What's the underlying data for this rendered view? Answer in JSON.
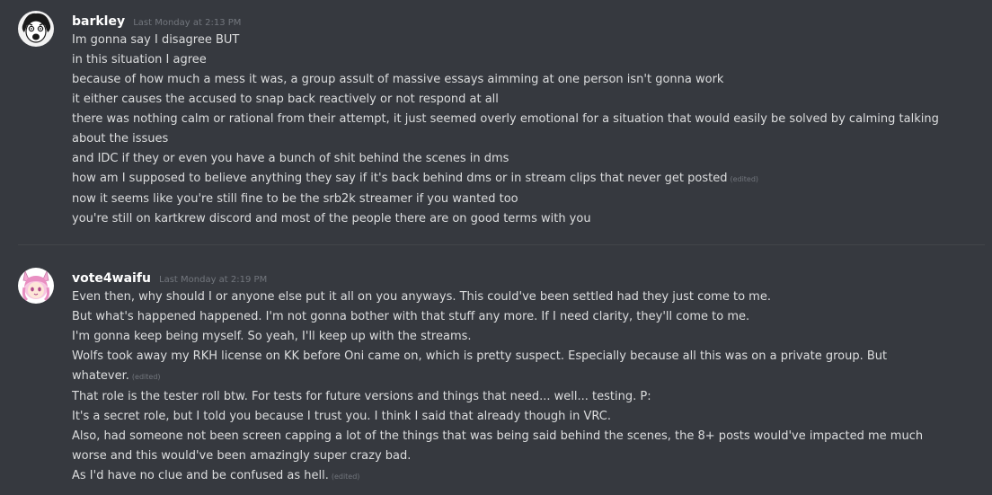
{
  "messages": [
    {
      "username": "barkley",
      "timestamp": "Last Monday at 2:13 PM",
      "avatar_icon": "avatar-barkley-icon",
      "lines": [
        {
          "text": "Im gonna say I disagree BUT",
          "edited": ""
        },
        {
          "text": "in this situation I agree",
          "edited": ""
        },
        {
          "text": "because of how much a mess it was, a group assult of massive essays aimming at one person isn't gonna work",
          "edited": ""
        },
        {
          "text": "it either causes the accused to snap back reactively or not respond at all",
          "edited": ""
        },
        {
          "text": "there was nothing calm or rational from their attempt, it just seemed overly emotional for a situation that would easily be solved by calming talking",
          "edited": ""
        },
        {
          "text": "about the issues",
          "edited": ""
        },
        {
          "text": "and IDC if they or even you have a bunch of shit behind the scenes in dms",
          "edited": ""
        },
        {
          "text": "how am I supposed to believe anything they say if it's back behind dms or in stream clips that never get posted",
          "edited": "(edited)"
        },
        {
          "text": "now it seems like you're still fine to be the srb2k streamer if you wanted too",
          "edited": ""
        },
        {
          "text": "you're still on kartkrew discord and most of the people there are on good terms with you",
          "edited": ""
        }
      ]
    },
    {
      "username": "vote4waifu",
      "timestamp": "Last Monday at 2:19 PM",
      "avatar_icon": "avatar-vote4waifu-icon",
      "lines": [
        {
          "text": "Even then, why should I or anyone else put it all on you anyways. This could've been settled had they just come to me.",
          "edited": ""
        },
        {
          "text": "But what's happened happened. I'm not gonna bother with that stuff any more. If I need clarity, they'll come to me.",
          "edited": ""
        },
        {
          "text": "I'm gonna keep being myself. So yeah, I'll keep up with the streams.",
          "edited": ""
        },
        {
          "text": "Wolfs took away my RKH license on KK before Oni came on, which is pretty suspect. Especially because all this was on a private group. But",
          "edited": ""
        },
        {
          "text": "whatever.",
          "edited": "(edited)"
        },
        {
          "text": "That role is the tester roll btw. For tests for future versions and things that need... well... testing. P:",
          "edited": ""
        },
        {
          "text": "It's a secret role, but I told you because I trust you. I think I said that already though in VRC.",
          "edited": ""
        },
        {
          "text": "Also, had someone not been screen capping a lot of the things that was being said behind the scenes, the 8+ posts would've impacted me much",
          "edited": ""
        },
        {
          "text": "worse and this would've been amazingly super crazy bad.",
          "edited": ""
        },
        {
          "text": "As I'd have no clue and be confused as hell.",
          "edited": "(edited)"
        }
      ]
    }
  ],
  "colors": {
    "background": "#36393f",
    "username": "#ffffff",
    "text": "#dcddde",
    "muted": "#72767d",
    "divider": "#42454a"
  }
}
